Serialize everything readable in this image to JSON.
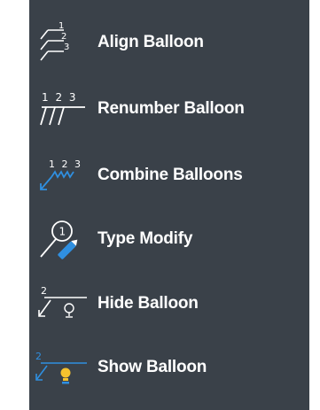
{
  "menu": {
    "items": [
      {
        "label": "Align Balloon",
        "icon": "align-balloon-icon"
      },
      {
        "label": "Renumber Balloon",
        "icon": "renumber-balloon-icon"
      },
      {
        "label": "Combine Balloons",
        "icon": "combine-balloons-icon"
      },
      {
        "label": "Type Modify",
        "icon": "type-modify-icon"
      },
      {
        "label": "Hide Balloon",
        "icon": "hide-balloon-icon"
      },
      {
        "label": "Show Balloon",
        "icon": "show-balloon-icon"
      }
    ],
    "icon_glyphs": {
      "align_numbers": [
        "1",
        "2",
        "3"
      ],
      "renumber_numbers": "1 2 3",
      "combine_numbers": "1 2 3",
      "type_modify_number": "1",
      "hide_number": "2",
      "show_number": "2"
    },
    "colors": {
      "background": "#3a4149",
      "text": "#ffffff",
      "accent_blue": "#2f8fe0",
      "bulb_yellow": "#f5c12e"
    }
  }
}
